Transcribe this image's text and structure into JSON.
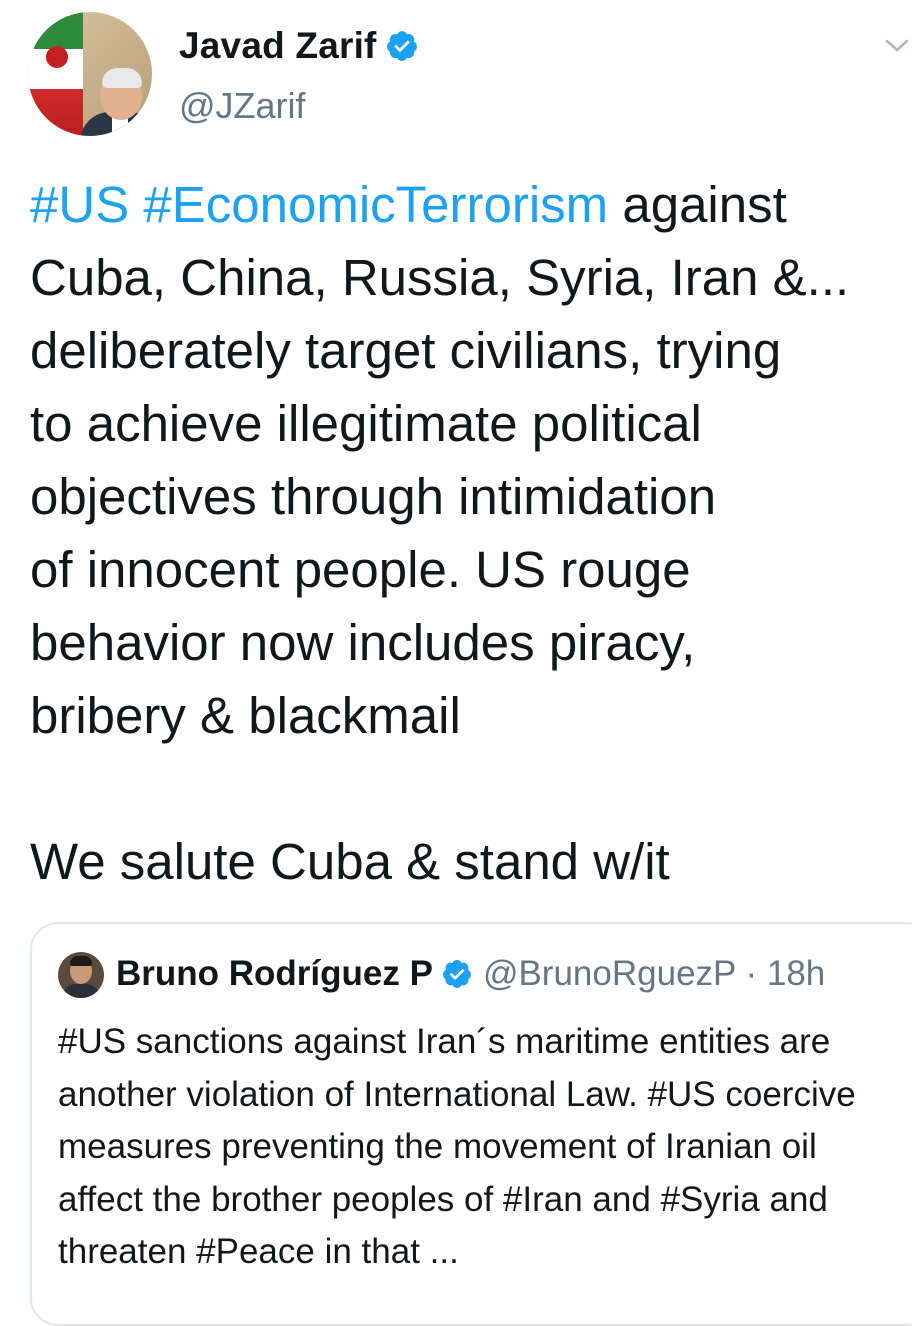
{
  "tweet": {
    "author_name": "Javad Zarif",
    "author_handle": "@JZarif",
    "text_segments": [
      {
        "text": "#US #EconomicTerrorism",
        "hashtag": true
      },
      {
        "text": " against\nCuba, China, Russia, Syria, Iran &...\ndeliberately target civilians, trying\nto achieve illegitimate political\nobjectives through intimidation\nof innocent people. US rouge\nbehavior now includes piracy,\nbribery & blackmail\n\nWe salute Cuba & stand w/it",
        "hashtag": false
      }
    ]
  },
  "quoted_tweet": {
    "author_name": "Bruno Rodríguez P",
    "author_handle": "@BrunoRguezP",
    "separator": "·",
    "time": "18h",
    "text": "#US sanctions against Iran´s maritime entities are another violation of International Law. #US coercive measures preventing the movement of Iranian oil affect the brother peoples of #Iran and #Syria and threaten #Peace in that ..."
  },
  "icons": {
    "verified": "verified-badge-icon",
    "menu": "chevron-down-icon"
  },
  "colors": {
    "hashtag": "#1da1f2",
    "verified": "#1da1f2",
    "secondary_text": "#657786",
    "border": "#e1e8ed"
  }
}
